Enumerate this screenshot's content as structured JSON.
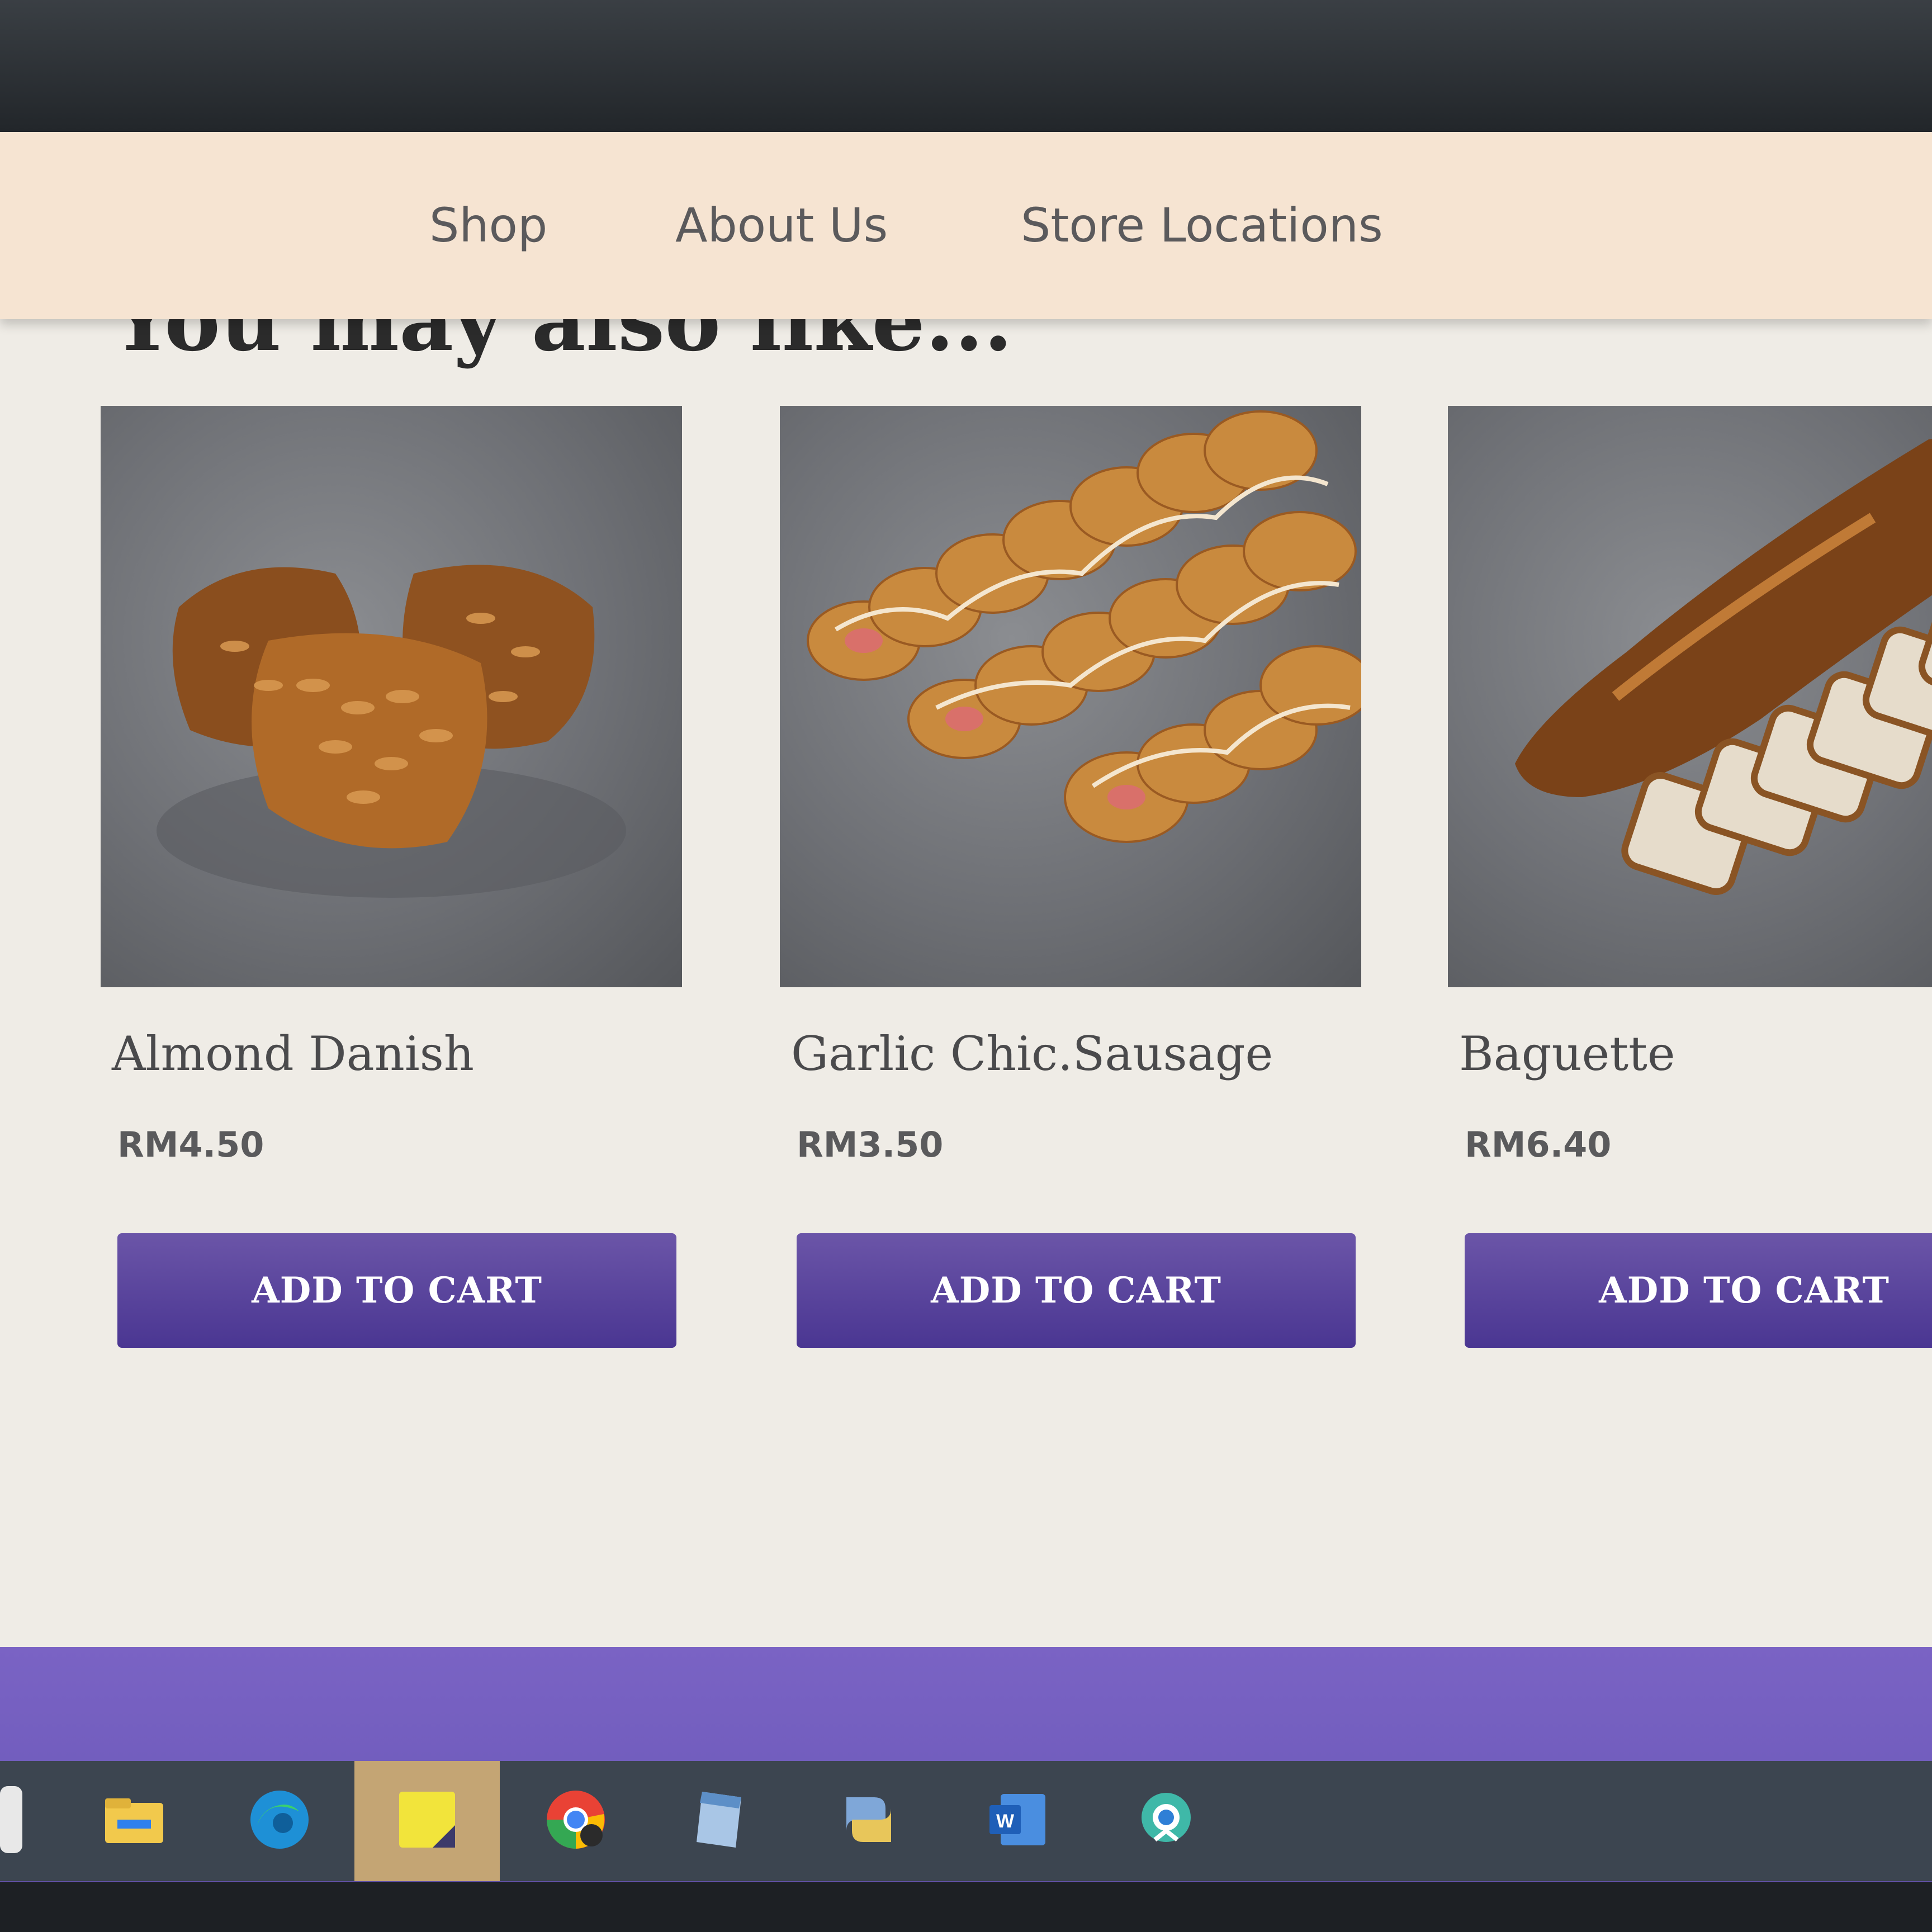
{
  "nav": {
    "items": [
      {
        "label": "Shop"
      },
      {
        "label": "About Us"
      },
      {
        "label": "Store Locations"
      }
    ]
  },
  "section": {
    "heading": "You may also like..."
  },
  "products": [
    {
      "name": "Almond Danish",
      "price": "RM4.50",
      "button": "ADD TO CART"
    },
    {
      "name": "Garlic Chic.Sausage",
      "price": "RM3.50",
      "button": "ADD TO CART"
    },
    {
      "name": "Baguette",
      "price": "RM6.40",
      "button": "ADD TO CART"
    }
  ],
  "taskbar": {
    "icons": [
      "task-view-icon",
      "file-explorer-icon",
      "edge-icon",
      "sticky-notes-icon",
      "chrome-icon",
      "notepad-icon",
      "python-icon",
      "word-icon",
      "app-icon"
    ]
  },
  "colors": {
    "nav_bg": "#f6e4d2",
    "button_purple": "#4a3692",
    "footer_purple": "#7a63c4",
    "page_bg": "#efece6"
  }
}
